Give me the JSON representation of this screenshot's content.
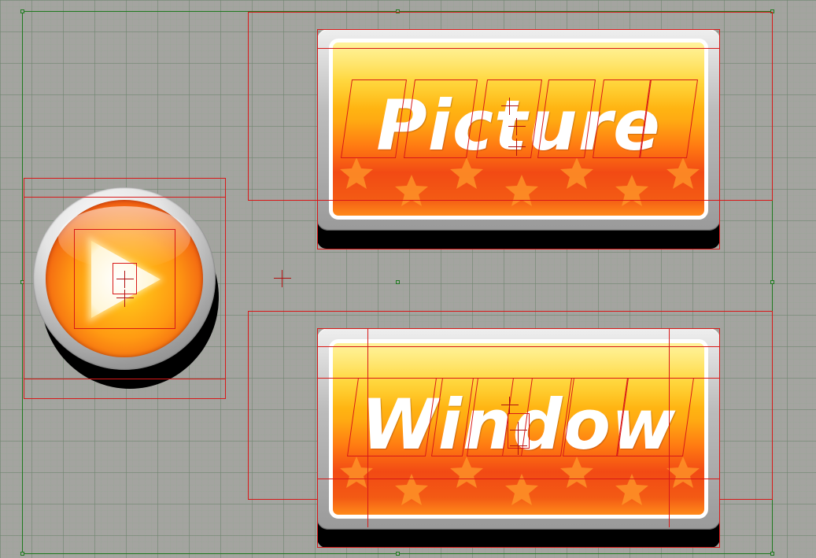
{
  "buttons": {
    "picture": {
      "label": "Picture"
    },
    "window": {
      "label": "Window"
    }
  },
  "icons": {
    "play": "play-icon",
    "star_pattern": "star-pattern"
  },
  "colors": {
    "canvas": "#a4a4a0",
    "guide_green": "#1e7a1e",
    "guide_red": "#d81818",
    "face_top": "#ffcb12",
    "face_bottom": "#f24a14",
    "label": "#ffffff"
  }
}
